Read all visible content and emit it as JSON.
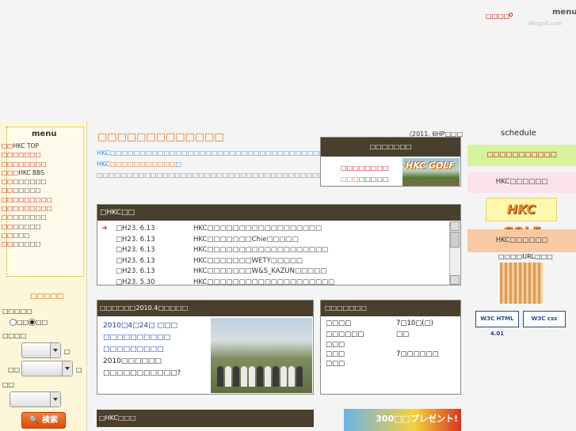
{
  "header": {
    "link": "□□□□",
    "marker": "o",
    "menu_label": "menu",
    "site": "hkcgolf.com"
  },
  "left_menu": {
    "title": "menu",
    "items": [
      {
        "mark": "□□",
        "label": "HKC TOP"
      },
      {
        "mark": "□□□□□□□",
        "label": ""
      },
      {
        "mark": "□□□□□□□□",
        "label": ""
      },
      {
        "mark": "□□□",
        "label": "HKC BBS"
      },
      {
        "mark": "□□",
        "label": "□□□□□□"
      },
      {
        "mark": "□□",
        "label": "□□□□□"
      },
      {
        "mark": "□□□□□□□□□",
        "label": ""
      },
      {
        "mark": "□□□□□□□□□",
        "label": ""
      },
      {
        "mark": "□□",
        "label": "□□□□□□"
      },
      {
        "mark": "□□",
        "label": "□□□□□"
      },
      {
        "mark": "□□",
        "label": "□□□"
      },
      {
        "mark": "□□",
        "label": "□□□□□"
      }
    ]
  },
  "search": {
    "title": "□□□□□",
    "kind_label": "□□□□□",
    "radio_a": "□□",
    "radio_b": "□□",
    "date_label": "□□□□",
    "suffix_a": "□",
    "label_b": "□□",
    "suffix_b": "□",
    "label_c": "□□",
    "button": "検索"
  },
  "center": {
    "title": "□□□□□□□□□□□□□",
    "intro_blue": "HKC□□□□□□□□□□□□□□□□□□□□□□□□□□□□□□□□□□□□□□□□→ HKC",
    "intro_orange": "□□□□□□□□□□□",
    "intro_tail": "□",
    "intro_second": "□□□□□□□□□□□□□□□□□□□□□□□□□□□□□□□□□□□□□□□□□□□□□□□□□□□□□□□"
  },
  "hp_panel": {
    "date_note": "（2011. 6HP□□□",
    "head": "□□□□□□□",
    "red": "□□□□□□□□",
    "green_prefix": "□□□",
    "green_suffix": "□□□□□",
    "logo": "HKC GOLF"
  },
  "news": {
    "head": "□HKC□□",
    "rows": [
      {
        "date": "□H23. 6.13",
        "title": "HKC□□□□□□□□□□□□□□□□□□"
      },
      {
        "date": "□H23. 6.13",
        "title": "HKC□□□□□□□Chie□□□□□"
      },
      {
        "date": "□H23. 6.13",
        "title": "HKC□□□□□□□□□□□□□□□□□□□"
      },
      {
        "date": "□H23. 6.13",
        "title": "HKC□□□□□□□WETY□□□□□"
      },
      {
        "date": "□H23. 6.13",
        "title": "HKC□□□□□□□W&S_KAZUN□□□□□"
      },
      {
        "date": "□H23. 5.30",
        "title": "HKC□□□□□□□□□□□□□□□□□□□□"
      }
    ]
  },
  "competition": {
    "head": "□□□□□□2010.4□□□□□",
    "line1": "2010□4□24□ □□□",
    "line2": "□□□□□□□□□□",
    "line3": "□□□□□□□□□",
    "line4": "2010□□□□□□",
    "line5": "□□□□□□□□□□□?"
  },
  "schedule_panel": {
    "head": "□□□□□□□",
    "rows": [
      {
        "label": "□□□□",
        "value": "7□10□(□)"
      },
      {
        "label": "□□□□□□",
        "value": "□□"
      },
      {
        "label": "□□□",
        "value": ""
      },
      {
        "label": "□□□",
        "value": "7□□□□□□"
      },
      {
        "label": "□□□",
        "value": ""
      }
    ]
  },
  "bottom": {
    "head": "□HKC□□□",
    "banner": "300□□プレゼント!"
  },
  "right": {
    "schedule_title": "schedule",
    "box1": "□□□□□□□□□□□",
    "box2": "HKC□□□□□□",
    "logo": "HKC GOLF",
    "box3": "HKC□□□□□□",
    "qr_label": "□□□□URL□□□",
    "w3c_html": "W3C HTML 4.01",
    "w3c_css": "W3C css"
  },
  "colors": {
    "accent_orange": "#e67817",
    "link_blue": "#3a8fd6",
    "panel_header": "#4a3e2c",
    "menu_red": "#cc0000"
  }
}
